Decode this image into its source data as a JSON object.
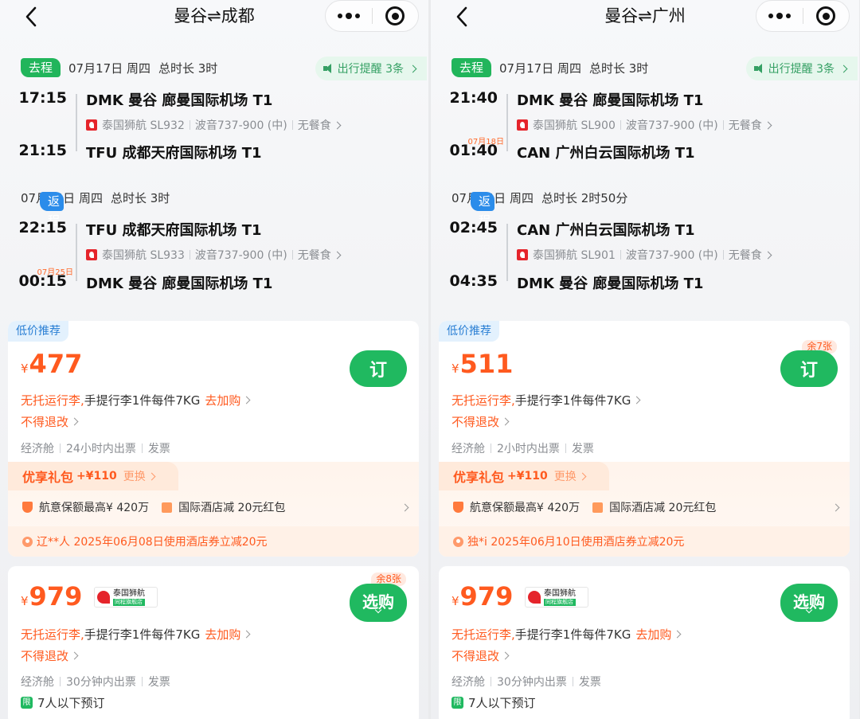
{
  "panels": [
    {
      "title": "曼谷⇌成都",
      "reminder": "出行提醒 3条",
      "outbound": {
        "tag": "去程",
        "date": "07月17日 周四",
        "duration": "总时长 3时",
        "dep_time": "17:15",
        "dep_airport": "DMK 曼谷 廊曼国际机场 T1",
        "airline": "泰国狮航 SL932",
        "aircraft": "波音737-900 (中)",
        "meal": "无餐食",
        "arr_time": "21:15",
        "arr_next_day": "",
        "arr_airport": "TFU 成都天府国际机场 T1"
      },
      "return": {
        "tag": "返程",
        "date": "07月24日 周四",
        "duration": "总时长 3时",
        "dep_time": "22:15",
        "dep_airport": "TFU 成都天府国际机场 T1",
        "airline": "泰国狮航 SL933",
        "aircraft": "波音737-900 (中)",
        "meal": "无餐食",
        "arr_time": "00:15",
        "arr_next_day": "07月25日",
        "arr_airport": "DMK 曼谷 廊曼国际机场 T1"
      },
      "offer1": {
        "tag": "低价推荐",
        "currency": "¥",
        "price": "477",
        "remaining": "",
        "button": "订",
        "bag_orange": "无托运行李,",
        "bag_text": "手提行李1件每件7KG",
        "bag_add": "去加购",
        "refund": "不得退改",
        "cabin": "经济舱",
        "ticketing": "24小时内出票",
        "invoice": "发票",
        "gift_title": "优享礼包",
        "gift_price": "+¥110",
        "gift_change": "更换",
        "gift_item1": "航意保额最高¥ 420万",
        "gift_item2": "国际酒店减 20元红包",
        "notice": "辽**人 2025年06月08日使用酒店券立减20元"
      },
      "offer2": {
        "currency": "¥",
        "price": "979",
        "remaining": "余8张",
        "button": "选购",
        "airline_badge": "泰国狮航",
        "airline_badge_sub": "同程旗舰店",
        "bag_orange": "无托运行李,",
        "bag_text": "手提行李1件每件7KG",
        "bag_add": "去加购",
        "refund": "不得退改",
        "cabin": "经济舱",
        "ticketing": "30分钟内出票",
        "invoice": "发票",
        "limit_badge": "限",
        "limit": "7人以下预订"
      }
    },
    {
      "title": "曼谷⇌广州",
      "reminder": "出行提醒 3条",
      "outbound": {
        "tag": "去程",
        "date": "07月17日 周四",
        "duration": "总时长 3时",
        "dep_time": "21:40",
        "dep_airport": "DMK 曼谷 廊曼国际机场 T1",
        "airline": "泰国狮航 SL900",
        "aircraft": "波音737-900 (中)",
        "meal": "无餐食",
        "arr_time": "01:40",
        "arr_next_day": "07月18日",
        "arr_airport": "CAN 广州白云国际机场 T1"
      },
      "return": {
        "tag": "返程",
        "date": "07月24日 周四",
        "duration": "总时长 2时50分",
        "dep_time": "02:45",
        "dep_airport": "CAN 广州白云国际机场 T1",
        "airline": "泰国狮航 SL901",
        "aircraft": "波音737-900 (中)",
        "meal": "无餐食",
        "arr_time": "04:35",
        "arr_next_day": "",
        "arr_airport": "DMK 曼谷 廊曼国际机场 T1"
      },
      "offer1": {
        "tag": "低价推荐",
        "currency": "¥",
        "price": "511",
        "remaining": "余7张",
        "button": "订",
        "bag_orange": "无托运行李,",
        "bag_text": "手提行李1件每件7KG",
        "bag_add": "",
        "refund": "不得退改",
        "cabin": "经济舱",
        "ticketing": "2小时内出票",
        "invoice": "发票",
        "gift_title": "优享礼包",
        "gift_price": "+¥110",
        "gift_change": "更换",
        "gift_item1": "航意保额最高¥ 420万",
        "gift_item2": "国际酒店减 20元红包",
        "notice": "独*i 2025年06月10日使用酒店券立减20元"
      },
      "offer2": {
        "currency": "¥",
        "price": "979",
        "remaining": "",
        "button": "选购",
        "airline_badge": "泰国狮航",
        "airline_badge_sub": "同程旗舰店",
        "bag_orange": "无托运行李,",
        "bag_text": "手提行李1件每件7KG",
        "bag_add": "去加购",
        "refund": "不得退改",
        "cabin": "经济舱",
        "ticketing": "30分钟内出票",
        "invoice": "发票",
        "limit_badge": "限",
        "limit": "7人以下预订"
      }
    }
  ]
}
